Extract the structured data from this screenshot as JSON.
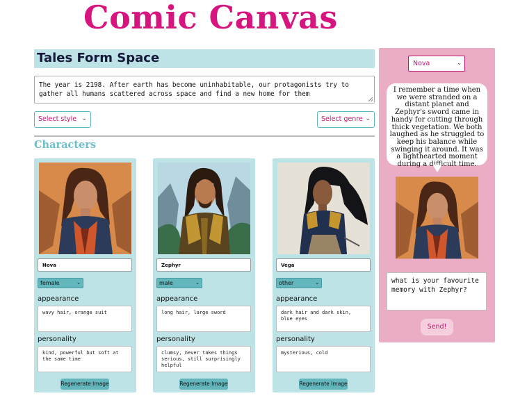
{
  "app": {
    "title": "Comic Canvas"
  },
  "story": {
    "title": "Tales Form Space",
    "text": "The year is 2198. After earth has become uninhabitable, our protagonists try to gather all humans scattered across space and find a new home for them"
  },
  "controls": {
    "style_select": "Select style",
    "genre_select": "Select genre"
  },
  "characters_section": {
    "title": "Characters",
    "appearance_label": "appearance",
    "personality_label": "personality",
    "regenerate_label": "Regenerate Image"
  },
  "characters": [
    {
      "name": "Nova",
      "gender": "female",
      "appearance": "wavy hair, orange suit",
      "personality": "kind, powerful but soft at the same time"
    },
    {
      "name": "Zephyr",
      "gender": "male",
      "appearance": "long hair, large sword",
      "personality": "clumsy, never takes things serious, still surprisingly helpful"
    },
    {
      "name": "Vega",
      "gender": "other",
      "appearance": "dark hair and dark skin, blue eyes",
      "personality": "mysterious, cold"
    }
  ],
  "chat": {
    "selected_character": "Nova",
    "reply": "I remember a time when we were stranded on a distant planet and Zephyr's sword came in handy for cutting through thick vegetation. We both laughed as he struggled to keep his balance while swinging it around. It was a lighthearted moment during a difficult time.",
    "input_value": "what is your favourite memory with Zephyr?",
    "send_label": "Send!"
  },
  "colors": {
    "brand_magenta": "#d6157f",
    "teal_panel": "#bde3e6",
    "teal_button": "#64b6bd",
    "chat_pink": "#ebadc6",
    "section_title_teal": "#6cbec9"
  },
  "icons": {
    "dropdown": "chevron-down-icon",
    "resize": "resize-grip-icon"
  }
}
